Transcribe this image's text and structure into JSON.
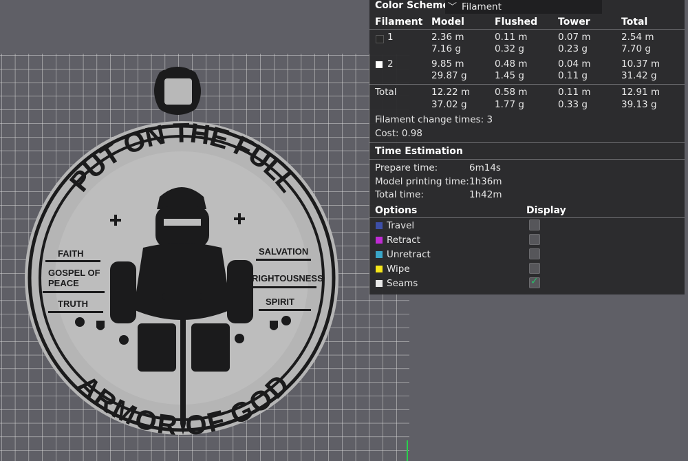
{
  "colors": {
    "viewport_bg": "#5f5f66",
    "grid_line": "#d6d6d6",
    "print_dark": "#1b1b1c",
    "print_light": "#b8b8b8",
    "panel_bg": "#2a2a2c",
    "check_green": "#26c26b"
  },
  "model_text": {
    "arc_top": "PUT ON THE FULL",
    "arc_bottom": "ARMOR OF GOD",
    "left": [
      "FAITH",
      "GOSPEL OF",
      "PEACE",
      "TRUTH"
    ],
    "right": [
      "SALVATION",
      "RIGHTOUSNESS",
      "SPIRIT"
    ]
  },
  "color_scheme": {
    "label": "Color Scheme",
    "selected": "Filament",
    "chevron_icon": "chevron-down-icon"
  },
  "filament_table": {
    "headers": [
      "Filament",
      "Model",
      "Flushed",
      "Tower",
      "Total"
    ],
    "rows": [
      {
        "id": "1",
        "swatch": "#2a2a2a",
        "model": [
          "2.36 m",
          "7.16 g"
        ],
        "flushed": [
          "0.11 m",
          "0.32 g"
        ],
        "tower": [
          "0.07 m",
          "0.23 g"
        ],
        "total": [
          "2.54 m",
          "7.70 g"
        ]
      },
      {
        "id": "2",
        "swatch": "#ffffff",
        "model": [
          "9.85 m",
          "29.87 g"
        ],
        "flushed": [
          "0.48 m",
          "1.45 g"
        ],
        "tower": [
          "0.04 m",
          "0.11 g"
        ],
        "total": [
          "10.37 m",
          "31.42 g"
        ]
      }
    ],
    "total_row": {
      "label": "Total",
      "model": [
        "12.22 m",
        "37.02 g"
      ],
      "flushed": [
        "0.58 m",
        "1.77 g"
      ],
      "tower": [
        "0.11 m",
        "0.33 g"
      ],
      "total": [
        "12.91 m",
        "39.13 g"
      ]
    }
  },
  "summary": {
    "filament_change_label": "Filament change times:",
    "filament_change_value": "3",
    "cost_label": "Cost:",
    "cost_value": "0.98"
  },
  "time_estimation": {
    "title": "Time Estimation",
    "rows": [
      {
        "label": "Prepare time:",
        "value": "6m14s"
      },
      {
        "label": "Model printing time:",
        "value": "1h36m"
      },
      {
        "label": "Total time:",
        "value": "1h42m"
      }
    ]
  },
  "options": {
    "col_options": "Options",
    "col_display": "Display",
    "items": [
      {
        "label": "Travel",
        "color": "#3d4fa8",
        "checked": false
      },
      {
        "label": "Retract",
        "color": "#c02bd4",
        "checked": false
      },
      {
        "label": "Unretract",
        "color": "#3aa6c8",
        "checked": false
      },
      {
        "label": "Wipe",
        "color": "#f5e61a",
        "checked": false
      },
      {
        "label": "Seams",
        "color": "#e9e9e9",
        "checked": true
      }
    ]
  }
}
